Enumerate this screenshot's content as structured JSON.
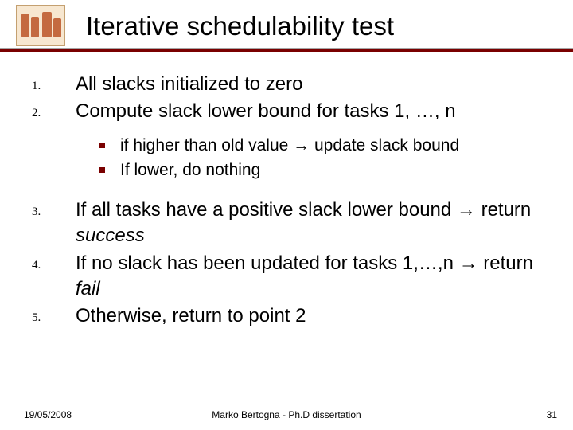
{
  "title": "Iterative schedulability test",
  "items": {
    "i1": "All slacks initialized to zero",
    "i2": "Compute slack lower bound for tasks 1, …, n",
    "i2_sub": {
      "a": "if higher than old value → update slack bound",
      "b": "If lower, do nothing"
    },
    "i3_pre": "If all tasks have a positive slack lower bound → return ",
    "i3_em": "success",
    "i4_pre": "If no slack has been updated for tasks 1,…,n → return ",
    "i4_em": "fail",
    "i5": "Otherwise, return to point 2"
  },
  "footer": {
    "date": "19/05/2008",
    "author": "Marko Bertogna - Ph.D dissertation",
    "page": "31"
  }
}
